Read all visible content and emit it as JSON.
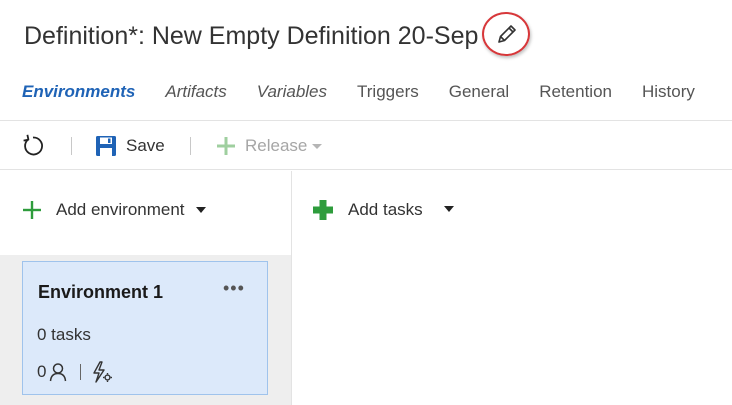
{
  "header": {
    "title": "Definition*: New Empty Definition 20-Sep",
    "edit_icon": "pencil-icon"
  },
  "tabs": [
    {
      "label": "Environments",
      "active": true
    },
    {
      "label": "Artifacts"
    },
    {
      "label": "Variables"
    },
    {
      "label": "Triggers"
    },
    {
      "label": "General"
    },
    {
      "label": "Retention"
    },
    {
      "label": "History"
    }
  ],
  "toolbar": {
    "refresh_icon": "refresh-icon",
    "save_label": "Save",
    "release_label": "Release"
  },
  "environments_pane": {
    "add_label": "Add environment",
    "environment": {
      "name": "Environment 1",
      "more": "•••",
      "tasks": "0 tasks",
      "approvers_count": "0"
    }
  },
  "tasks_pane": {
    "add_label": "Add tasks"
  },
  "colors": {
    "accent": "#1f63b6",
    "add_green": "#2e9c3c",
    "card_bg": "#dce9fa",
    "card_border": "#9fc3ec",
    "highlight_ring": "#d7373a"
  }
}
